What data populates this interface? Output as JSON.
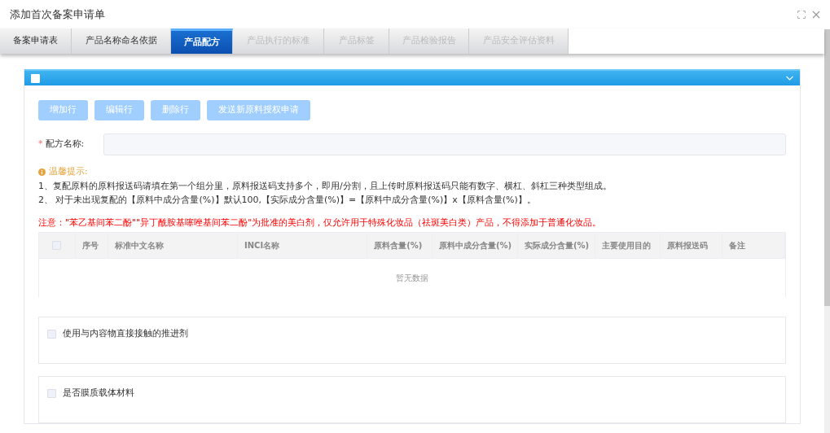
{
  "window": {
    "title": "添加首次备案申请单"
  },
  "tabs": [
    {
      "label": "备案申请表",
      "selected": false,
      "disabled": false
    },
    {
      "label": "产品名称命名依据",
      "selected": false,
      "disabled": false
    },
    {
      "label": "产品配方",
      "selected": true,
      "disabled": false
    },
    {
      "label": "产品执行的标准",
      "selected": false,
      "disabled": true
    },
    {
      "label": "产品标签",
      "selected": false,
      "disabled": true
    },
    {
      "label": "产品检验报告",
      "selected": false,
      "disabled": true
    },
    {
      "label": "产品安全评估资料",
      "selected": false,
      "disabled": true
    }
  ],
  "panel": {
    "checked": false,
    "expanded": true
  },
  "buttons": [
    {
      "label": "增加行",
      "disabled": true
    },
    {
      "label": "编辑行",
      "disabled": true
    },
    {
      "label": "删除行",
      "disabled": true
    },
    {
      "label": "发送新原料授权申请",
      "disabled": true
    }
  ],
  "formula_field": {
    "required_mark": "*",
    "label": "配方名称:"
  },
  "hint": {
    "title": "温馨提示:",
    "lines": [
      "1、复配原料的原料报送码请填在第一个组分里，原料报送码支持多个，即用/分割，且上传时原料报送码只能有数字、横杠、斜杠三种类型组成。",
      "2、 对于未出现复配的【原料中成分含量(%)】默认100,【实际成分含量(%)】=【原料中成分含量(%)】x【原料含量(%)】。"
    ]
  },
  "warning": "注意：\"苯乙基间苯二酚\"\"异丁酰胺基噻唑基间苯二酚\"为批准的美白剂，仅允许用于特殊化妆品（祛斑美白类）产品，不得添加于普通化妆品。",
  "table": {
    "select_all_checked": false,
    "columns": [
      "序号",
      "标准中文名称",
      "INCI名称",
      "原料含量(%)",
      "原料中成分含量(%)",
      "实际成分含量(%)",
      "主要使用目的",
      "原料报送码",
      "备注"
    ],
    "empty_text": "暂无数据"
  },
  "options": [
    {
      "label": "使用与内容物直接接触的推进剂",
      "checked": false
    },
    {
      "label": "是否膜质载体材料",
      "checked": false
    }
  ]
}
